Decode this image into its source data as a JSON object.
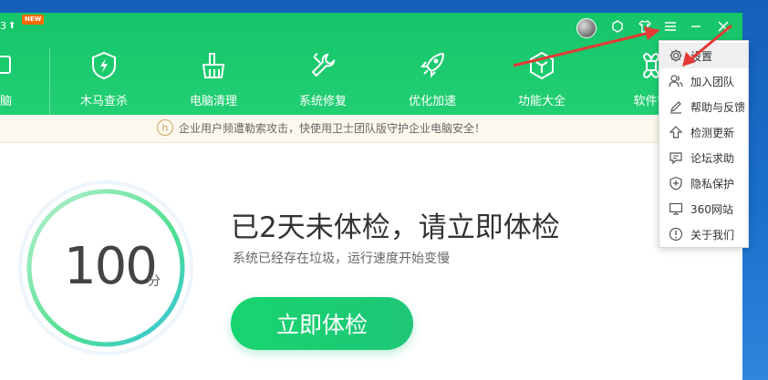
{
  "app": {
    "version_fragment": "3",
    "new_badge": "NEW"
  },
  "nav": {
    "items": [
      {
        "label": "电脑",
        "icon": "pc-icon"
      },
      {
        "label": "木马查杀",
        "icon": "shield-bolt-icon"
      },
      {
        "label": "电脑清理",
        "icon": "broom-icon"
      },
      {
        "label": "系统修复",
        "icon": "wrench-icon"
      },
      {
        "label": "优化加速",
        "icon": "rocket-icon"
      },
      {
        "label": "功能大全",
        "icon": "cube-icon"
      },
      {
        "label": "软件管",
        "icon": "flower-icon"
      }
    ]
  },
  "notice": {
    "text": "企业用户频遭勒索攻击，快使用卫士团队版守护企业电脑安全！"
  },
  "main": {
    "score": "100",
    "score_unit": "分",
    "headline": "已2天未体检，请立即体检",
    "subline": "系统已经存在垃圾，运行速度开始变慢",
    "scan_button": "立即体检"
  },
  "menu": {
    "items": [
      {
        "label": "设置",
        "icon": "gear-icon",
        "active": true
      },
      {
        "label": "加入团队",
        "icon": "team-icon"
      },
      {
        "label": "帮助与反馈",
        "icon": "pen-icon"
      },
      {
        "label": "检测更新",
        "icon": "upload-icon"
      },
      {
        "label": "论坛求助",
        "icon": "forum-icon"
      },
      {
        "label": "隐私保护",
        "icon": "privacy-shield-icon"
      },
      {
        "label": "360网站",
        "icon": "monitor-icon"
      },
      {
        "label": "关于我们",
        "icon": "info-icon"
      }
    ]
  },
  "colors": {
    "header_green": "#1fcb70",
    "button_green": "#1ec777",
    "annotation_red": "#e53935",
    "desktop_blue": "#1a6fcc"
  }
}
